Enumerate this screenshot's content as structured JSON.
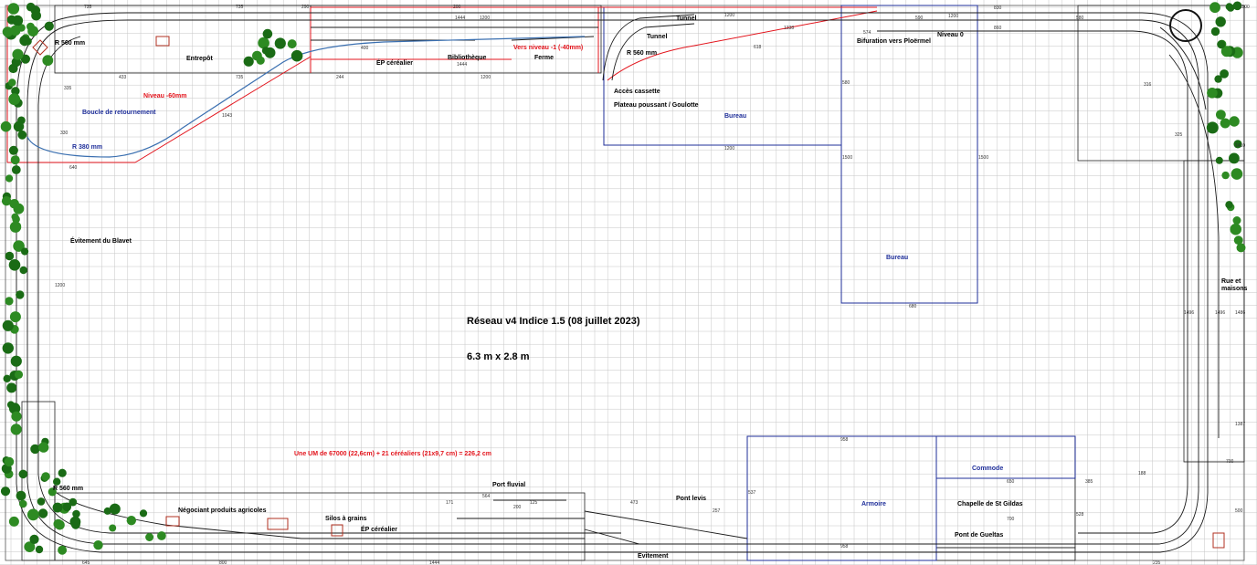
{
  "diagram": {
    "title": "Réseau v4  Indice 1.5 (08 juillet 2023)",
    "size": "6.3 m x 2.8 m",
    "note_train": "Une UM de 67000 (22,6cm) + 21 céréaliers (21x9,7 cm) = 226,2 cm"
  },
  "labels": {
    "entrepot": "Entrepôt",
    "ep_cerealier_top": "ÉP céréalier",
    "bibliotheque": "Bibliothèque",
    "ferme": "Ferme",
    "vers_niveau": "Vers niveau -1 (-40mm)",
    "tunnel_1": "Tunnel",
    "tunnel_2": "Tunnel",
    "r560": "R 560 mm",
    "acces_cassette": "Accès cassette",
    "plateau": "Plateau poussant / Goulotte",
    "bureau_1": "Bureau",
    "bureau_2": "Bureau",
    "bifurcation": "Bifuration vers Ploërmel",
    "niveau0": "Niveau 0",
    "niveau_m60": "Niveau -60mm",
    "boucle": "Boucle de retournement",
    "r380": "R 380 mm",
    "r_top_left": "R 560 mm",
    "evitement_blavet": "Évitement du Blavet",
    "rue_maisons": "Rue et maisons",
    "port_fluvial": "Port fluvial",
    "pont_levis": "Pont levis",
    "negociant": "Négociant produits agricoles",
    "silos": "Silos à grains",
    "ep_cerealier_bottom": "ÉP céréalier",
    "evitement": "Évitement",
    "armoire": "Armoire",
    "commode": "Commode",
    "chapelle": "Chapelle de St Gildas",
    "pont_gueltas": "Pont de Gueltas",
    "r_bottom_left": "R 560 mm"
  },
  "dims": {
    "d735": "735",
    "d735b": "735",
    "d290": "290",
    "d200": "200",
    "d1200": "1200",
    "d1444": "1444",
    "d1200b": "1200",
    "d400": "400",
    "d244": "244",
    "d1200c": "1200",
    "d1444b": "1444",
    "d433": "433",
    "d735c": "735",
    "d1043": "1043",
    "d640": "640",
    "d330": "330",
    "d1200d": "1200",
    "d335": "335",
    "d1200e": "1200",
    "d580": "580",
    "d1500": "1500",
    "d1500b": "1500",
    "d680": "680",
    "d574": "574",
    "d618": "618",
    "d1338": "1338",
    "d590": "590",
    "d860": "860",
    "d830": "830",
    "d580b": "580",
    "d1100": "1100",
    "d316": "316",
    "d325": "325",
    "d1410": "1410",
    "d1496": "1496",
    "d1496b": "1496",
    "d1486": "1486",
    "d1387": "1387",
    "d500": "500",
    "d700": "700",
    "d188": "188",
    "d385": "385",
    "d958": "958",
    "d537": "537",
    "d650": "650",
    "d528": "528",
    "d700b": "700",
    "d958b": "958",
    "d564": "564",
    "d200b": "200",
    "d125": "125",
    "d171": "171",
    "d473": "473",
    "d257": "257",
    "d800": "800",
    "d645": "645",
    "d1200f": "1200",
    "d1444c": "1444",
    "d235": "235"
  },
  "colors": {
    "grid": "#c6c6c6",
    "track": "#1a1a1a",
    "red": "#e3141c",
    "blue": "#1f2f9a",
    "tree": "#2d8a22",
    "tree_dark": "#1a6b15"
  }
}
